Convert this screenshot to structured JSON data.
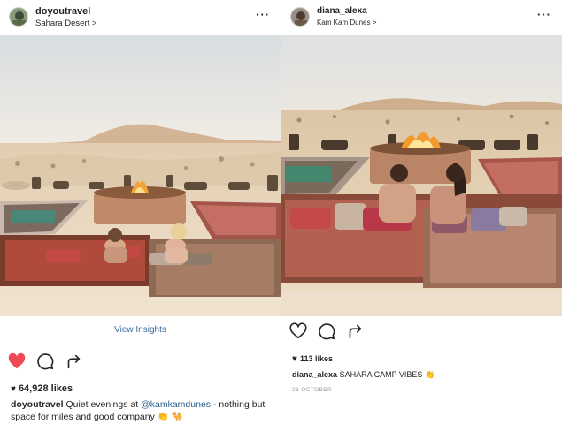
{
  "left_post": {
    "username": "doyoutravel",
    "location": "Sahara Desert >",
    "more_icon": "ellipsis-icon",
    "view_insights": "View Insights",
    "icons": [
      "heart-filled-icon",
      "comment-icon",
      "share-icon"
    ],
    "heart_color": "#ed4956",
    "likes": "64,928 likes",
    "caption_user": "doyoutravel",
    "caption_text_1": "Quiet evenings at",
    "caption_mention": "@kamkamdunes",
    "caption_text_2": "- nothing but space for miles and good company",
    "caption_emoji": "👏 🐪"
  },
  "right_post": {
    "username": "diana_alexa",
    "location": "Kam Kam Dunes >",
    "more_icon": "ellipsis-icon",
    "icons": [
      "heart-outline-icon",
      "comment-icon",
      "share-icon"
    ],
    "likes": "113 likes",
    "caption_user": "diana_alexa",
    "caption_text": "SAHARA CAMP VIBES",
    "caption_emoji": "👏",
    "date": "28 OCTOBER"
  },
  "colors": {
    "link": "#3b6d9e",
    "mention": "#2a5e8c",
    "text": "#262626",
    "muted": "#999999"
  }
}
